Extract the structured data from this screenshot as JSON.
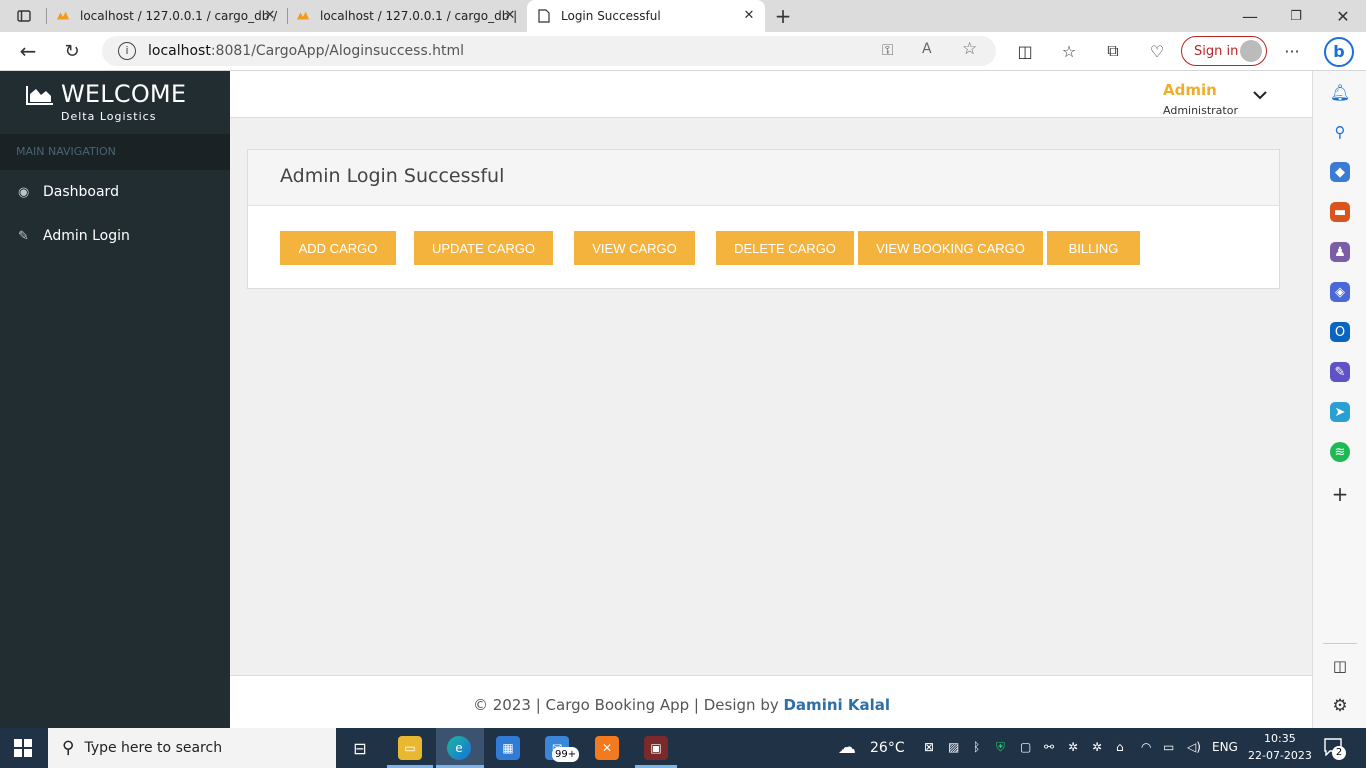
{
  "browser": {
    "tabs": [
      {
        "label": "localhost / 127.0.0.1 / cargo_db /",
        "active": false
      },
      {
        "label": "localhost / 127.0.0.1 / cargo_db |",
        "active": false
      },
      {
        "label": "Login Successful",
        "active": true
      }
    ],
    "url_host": "localhost",
    "url_rest": ":8081/CargoApp/Aloginsuccess.html",
    "signin_label": "Sign in"
  },
  "sidebar": {
    "brand_title": "WELCOME",
    "brand_subtitle": "Delta Logistics",
    "nav_header": "MAIN NAVIGATION",
    "items": [
      {
        "label": "Dashboard",
        "icon": "dashboard-icon"
      },
      {
        "label": "Admin Login",
        "icon": "edit-icon"
      }
    ]
  },
  "header": {
    "user_name": "Admin",
    "user_role": "Administrator"
  },
  "main": {
    "box_title": "Admin Login Successful",
    "buttons": [
      {
        "label": "ADD CARGO"
      },
      {
        "label": "UPDATE CARGO"
      },
      {
        "label": "VIEW CARGO"
      },
      {
        "label": "DELETE CARGO"
      },
      {
        "label": "VIEW BOOKING CARGO"
      },
      {
        "label": "BILLING"
      }
    ]
  },
  "footer": {
    "text": "© 2023 | Cargo Booking App | Design by ",
    "author": "Damini Kalal"
  },
  "taskbar": {
    "search_placeholder": "Type here to search",
    "mail_badge": "99+",
    "weather": "26°C",
    "language": "ENG",
    "time": "10:35",
    "date": "22-07-2023",
    "notification_count": "2"
  },
  "colors": {
    "sidebar_bg": "#222d32",
    "button_bg": "#f3b33d",
    "admin_name": "#f0ad2d",
    "author_link": "#2d6fa6"
  }
}
